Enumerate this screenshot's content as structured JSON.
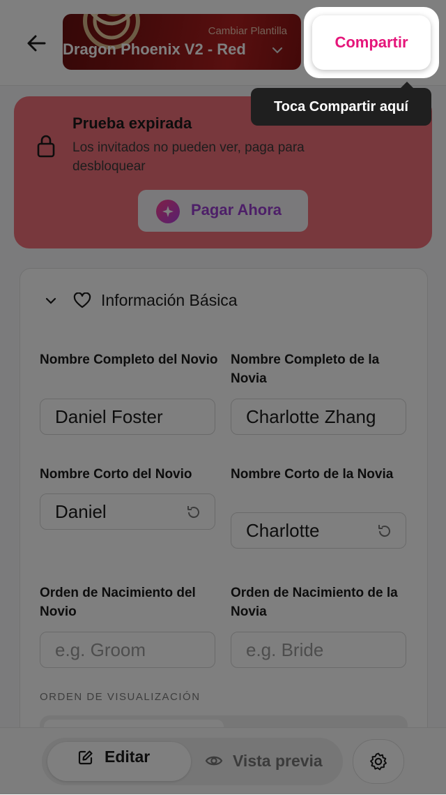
{
  "header": {
    "back_icon": "arrow-left-icon",
    "template_sub": "Cambiar Plantilla",
    "template_name": "Dragon Phoenix V2 - Red",
    "share_label": "Compartir"
  },
  "tooltip": {
    "text": "Toca Compartir aquí"
  },
  "trial": {
    "title": "Prueba expirada",
    "description": "Los invitados no pueden ver, paga para desbloquear",
    "pay_label": "Pagar Ahora",
    "lock_icon": "lock-icon",
    "pay_icon": "sparkle-icon"
  },
  "basic_info": {
    "title": "Información Básica",
    "groom_full_label": "Nombre Completo del Novio",
    "groom_full_value": "Daniel Foster",
    "bride_full_label": "Nombre Completo de la Novia",
    "bride_full_value": "Charlotte Zhang",
    "groom_short_label": "Nombre Corto del Novio",
    "groom_short_value": "Daniel",
    "bride_short_label": "Nombre Corto de la Novia",
    "bride_short_value": "Charlotte",
    "groom_order_label": "Orden de Nacimiento del Novio",
    "groom_order_placeholder": "e.g. Groom",
    "bride_order_label": "Orden de Nacimiento de la Novia",
    "bride_order_placeholder": "e.g. Bride",
    "display_order_caption": "ORDEN DE VISUALIZACIÓN"
  },
  "bottom_nav": {
    "edit_label": "Editar",
    "preview_label": "Vista previa",
    "settings_icon": "gear-icon"
  },
  "colors": {
    "accent": "#e5157a",
    "trial_card": "#f0707a",
    "pay_text": "#9b3fd0",
    "tooltip_bg": "#1f1f1f"
  }
}
